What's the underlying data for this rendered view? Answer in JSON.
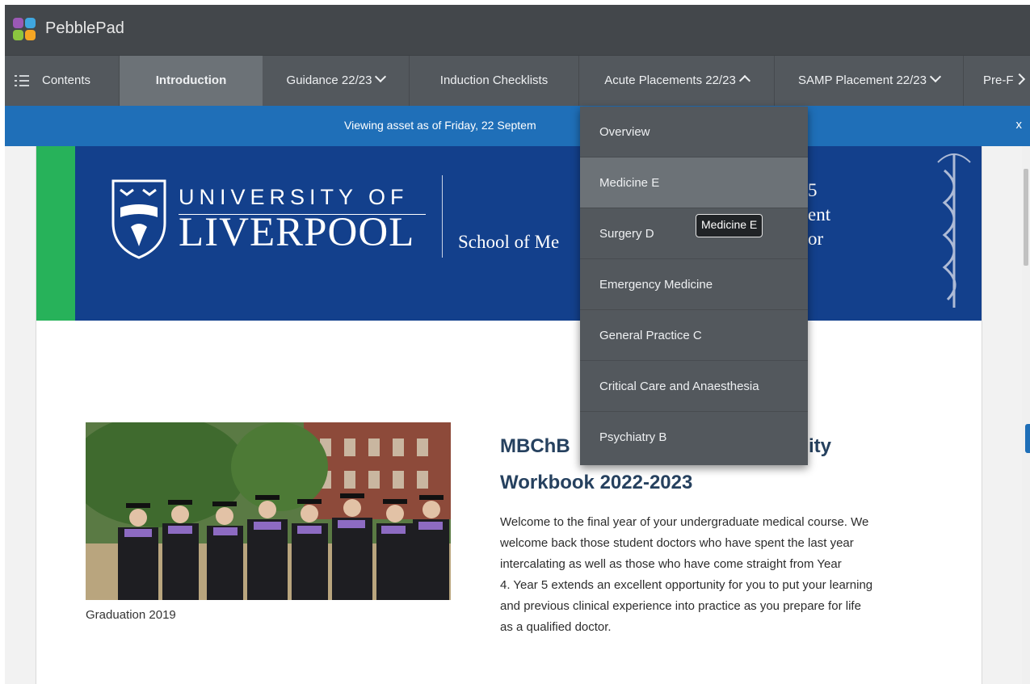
{
  "app": {
    "name": "PebblePad"
  },
  "nav": {
    "contents": "Contents",
    "items": [
      "Introduction",
      "Guidance 22/23",
      "Induction Checklists",
      "Acute Placements 22/23",
      "SAMP Placement 22/23",
      "Pre-F"
    ]
  },
  "banner": {
    "text": "Viewing asset as of Friday, 22 Septem",
    "close": "x"
  },
  "header_image": {
    "university_line1": "UNIVERSITY OF",
    "university_line2": "LIVERPOOL",
    "school": "School of Me",
    "right_line1": "5",
    "right_line2": "ent",
    "right_line3": "or"
  },
  "dropdown": {
    "items": [
      "Overview",
      "Medicine E",
      "Surgery D",
      "Emergency Medicine",
      "General Practice C",
      "Critical Care and Anaesthesia",
      "Psychiatry B"
    ],
    "tooltip": "Medicine E"
  },
  "content": {
    "photo_caption": "Graduation 2019",
    "title_line1_start": "MBChB",
    "title_line1_end": "ity",
    "title_line2": "Workbook 2022-2023",
    "paragraph": [
      "Welcome to the final year of your undergraduate medical course. We",
      "welcome back those student doctors who have spent the last year",
      "intercalating as well as those who have come straight from Year",
      "4. Year 5 extends an excellent opportunity for you to put your learning",
      "and previous clinical experience into practice as you prepare for life",
      "as a qualified doctor."
    ]
  },
  "colors": {
    "topbar": "#43474b",
    "navbar": "#53585d",
    "banner": "#1f6fb8",
    "header_blue": "#13408c",
    "accent_green": "#27b25a"
  }
}
